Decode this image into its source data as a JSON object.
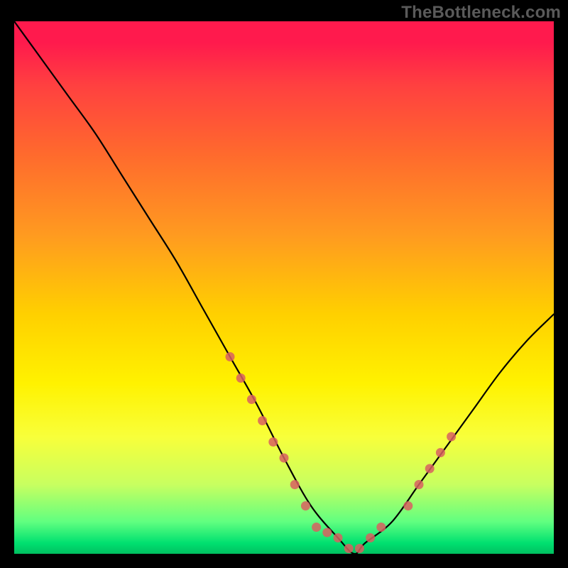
{
  "watermark": "TheBottleneck.com",
  "chart_data": {
    "type": "line",
    "title": "",
    "xlabel": "",
    "ylabel": "",
    "xlim": [
      0,
      100
    ],
    "ylim": [
      0,
      100
    ],
    "grid": false,
    "legend": false,
    "series": [
      {
        "name": "bottleneck-curve",
        "color": "#000000",
        "x": [
          0,
          5,
          10,
          15,
          20,
          25,
          30,
          35,
          40,
          45,
          50,
          55,
          60,
          63,
          65,
          70,
          75,
          80,
          85,
          90,
          95,
          100
        ],
        "values": [
          100,
          93,
          86,
          79,
          71,
          63,
          55,
          46,
          37,
          28,
          18,
          9,
          3,
          0,
          2,
          6,
          13,
          20,
          27,
          34,
          40,
          45
        ]
      }
    ],
    "markers": [
      {
        "name": "highlight-dots-left",
        "color": "#d86060",
        "x": [
          40,
          42,
          44,
          46,
          48,
          50,
          52,
          54
        ],
        "values": [
          37,
          33,
          29,
          25,
          21,
          18,
          13,
          9
        ]
      },
      {
        "name": "highlight-dots-bottom",
        "color": "#d86060",
        "x": [
          56,
          58,
          60,
          62,
          64,
          66,
          68
        ],
        "values": [
          5,
          4,
          3,
          1,
          1,
          3,
          5
        ]
      },
      {
        "name": "highlight-dots-right",
        "color": "#d86060",
        "x": [
          73,
          75,
          77,
          79,
          81
        ],
        "values": [
          9,
          13,
          16,
          19,
          22
        ]
      }
    ],
    "gradient_stops": [
      {
        "pos": 0,
        "color": "#ff1a4d"
      },
      {
        "pos": 12,
        "color": "#ff4040"
      },
      {
        "pos": 25,
        "color": "#ff6a2d"
      },
      {
        "pos": 40,
        "color": "#ff9a20"
      },
      {
        "pos": 55,
        "color": "#ffd000"
      },
      {
        "pos": 68,
        "color": "#fff200"
      },
      {
        "pos": 78,
        "color": "#f8ff3a"
      },
      {
        "pos": 87,
        "color": "#c8ff60"
      },
      {
        "pos": 94,
        "color": "#60ff80"
      },
      {
        "pos": 100,
        "color": "#00c060"
      }
    ]
  }
}
